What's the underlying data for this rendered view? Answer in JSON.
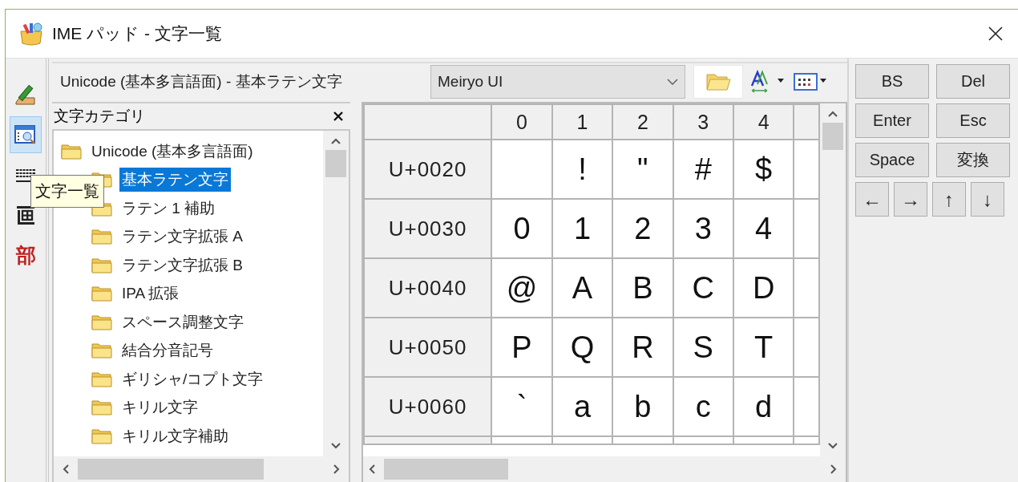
{
  "window": {
    "title": "IME パッド - 文字一覧"
  },
  "tool_strip": [
    {
      "kind": "handwriting",
      "selected": false
    },
    {
      "kind": "charlist",
      "selected": true
    },
    {
      "kind": "keyboard",
      "selected": false
    },
    {
      "kind": "strokes",
      "selected": false
    },
    {
      "kind": "glyph",
      "glyph": "部",
      "selected": false
    }
  ],
  "tooltip": "文字一覧",
  "header": {
    "label": "Unicode (基本多言語面) - 基本ラテン文字",
    "font": "Meiryo UI"
  },
  "category_panel": {
    "title": "文字カテゴリ",
    "tree": [
      {
        "label": "Unicode (基本多言語面)",
        "selected": false,
        "children": [
          {
            "label": "基本ラテン文字",
            "selected": true
          },
          {
            "label": "ラテン 1 補助",
            "selected": false
          },
          {
            "label": "ラテン文字拡張 A",
            "selected": false
          },
          {
            "label": "ラテン文字拡張 B",
            "selected": false
          },
          {
            "label": "IPA 拡張",
            "selected": false
          },
          {
            "label": "スペース調整文字",
            "selected": false
          },
          {
            "label": "結合分音記号",
            "selected": false
          },
          {
            "label": "ギリシャ/コプト文字",
            "selected": false
          },
          {
            "label": "キリル文字",
            "selected": false
          },
          {
            "label": "キリル文字補助",
            "selected": false
          }
        ]
      }
    ]
  },
  "grid": {
    "columns": [
      "0",
      "1",
      "2",
      "3",
      "4"
    ],
    "rows": [
      {
        "label": "U+0020",
        "cells": [
          " ",
          "!",
          "\"",
          "#",
          "$"
        ]
      },
      {
        "label": "U+0030",
        "cells": [
          "0",
          "1",
          "2",
          "3",
          "4"
        ]
      },
      {
        "label": "U+0040",
        "cells": [
          "@",
          "A",
          "B",
          "C",
          "D"
        ]
      },
      {
        "label": "U+0050",
        "cells": [
          "P",
          "Q",
          "R",
          "S",
          "T"
        ]
      },
      {
        "label": "U+0060",
        "cells": [
          "`",
          "a",
          "b",
          "c",
          "d"
        ]
      }
    ]
  },
  "keys": [
    {
      "label": "BS",
      "kind": "wide"
    },
    {
      "label": "Del",
      "kind": "wide"
    },
    {
      "label": "Enter",
      "kind": "wide"
    },
    {
      "label": "Esc",
      "kind": "wide"
    },
    {
      "label": "Space",
      "kind": "wide"
    },
    {
      "label": "変換",
      "kind": "wide"
    },
    {
      "label": "←",
      "kind": "arrow"
    },
    {
      "label": "→",
      "kind": "arrow"
    },
    {
      "label": "↑",
      "kind": "arrow"
    },
    {
      "label": "↓",
      "kind": "arrow"
    }
  ]
}
